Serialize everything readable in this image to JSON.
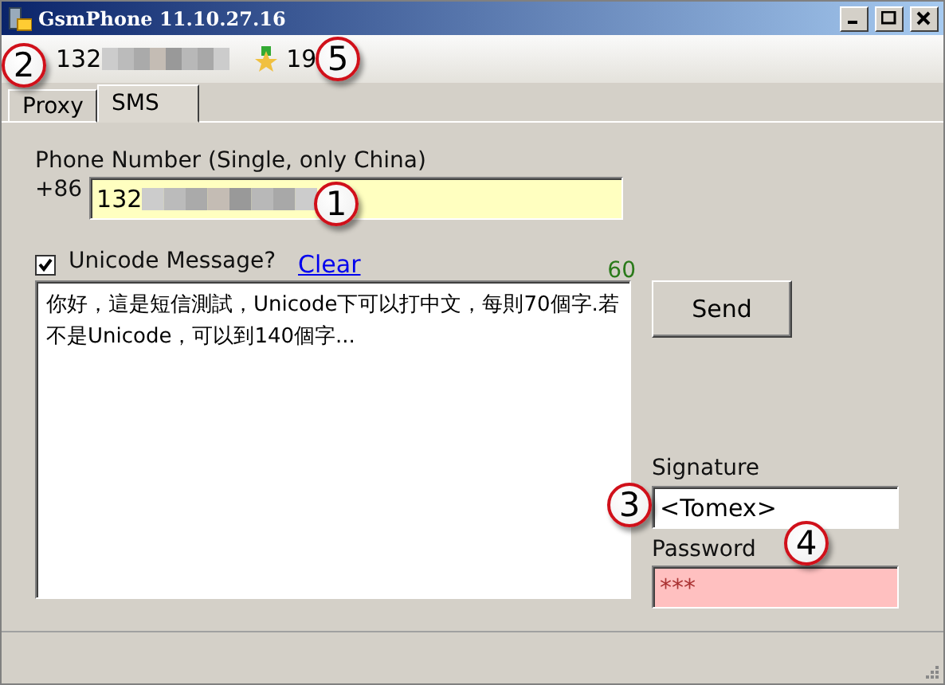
{
  "window": {
    "title": "GsmPhone 11.10.27.16"
  },
  "toolbar": {
    "phone": "132",
    "count": "19"
  },
  "tabs": [
    {
      "label": "Proxy",
      "selected": false
    },
    {
      "label": "SMS",
      "selected": true
    }
  ],
  "sms": {
    "phone_label": "Phone Number (Single, only China)",
    "country_code": "+86",
    "phone_value": "132",
    "unicode_label": "Unicode Message?",
    "unicode_checked": true,
    "clear_link": "Clear",
    "remaining": "60",
    "message": "你好，這是短信測試，Unicode下可以打中文，每則70個字.若不是Unicode，可以到140個字...",
    "send_button": "Send",
    "signature_label": "Signature",
    "signature_value": "<Tomex>",
    "password_label": "Password",
    "password_value": "***"
  },
  "callouts": [
    "1",
    "2",
    "3",
    "4",
    "5"
  ]
}
